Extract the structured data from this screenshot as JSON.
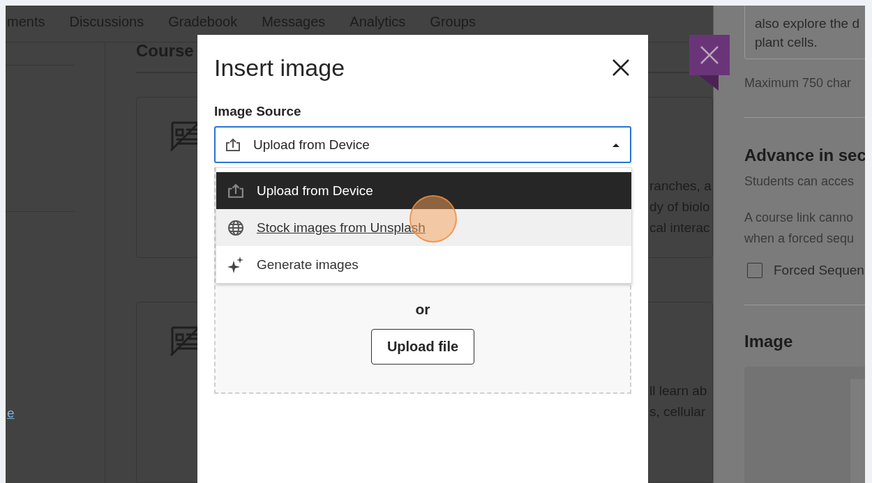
{
  "nav_tabs": [
    "ments",
    "Discussions",
    "Gradebook",
    "Messages",
    "Analytics",
    "Groups"
  ],
  "course_heading": "Course",
  "cards": [
    {
      "lines": [
        "ranches, a",
        "dy of biolo",
        "cal interac"
      ]
    },
    {
      "lines": [
        "ll learn ab",
        "s, cellular"
      ]
    }
  ],
  "sidebar": {
    "link": "e"
  },
  "right_panel": {
    "description_lines": [
      "also explore the d",
      "plant cells."
    ],
    "char_limit": "Maximum 750 char",
    "advance_heading": "Advance in sec",
    "advance_text": "Students can acces",
    "note_lines": [
      "A course link canno",
      "when a forced sequ"
    ],
    "forced_sequence": {
      "label": "Forced Sequen",
      "checked": false
    },
    "image_heading": "Image"
  },
  "modal": {
    "title": "Insert image",
    "source_label": "Image Source",
    "source_value": "Upload from Device",
    "options": [
      {
        "kind": "upload",
        "label": "Upload from Device",
        "selected": true,
        "hovered": false
      },
      {
        "kind": "globe",
        "label": "Stock images from Unsplash",
        "selected": false,
        "hovered": true
      },
      {
        "kind": "sparkle",
        "label": "Generate images",
        "selected": false,
        "hovered": false
      }
    ],
    "or": "or",
    "upload_button": "Upload file"
  }
}
